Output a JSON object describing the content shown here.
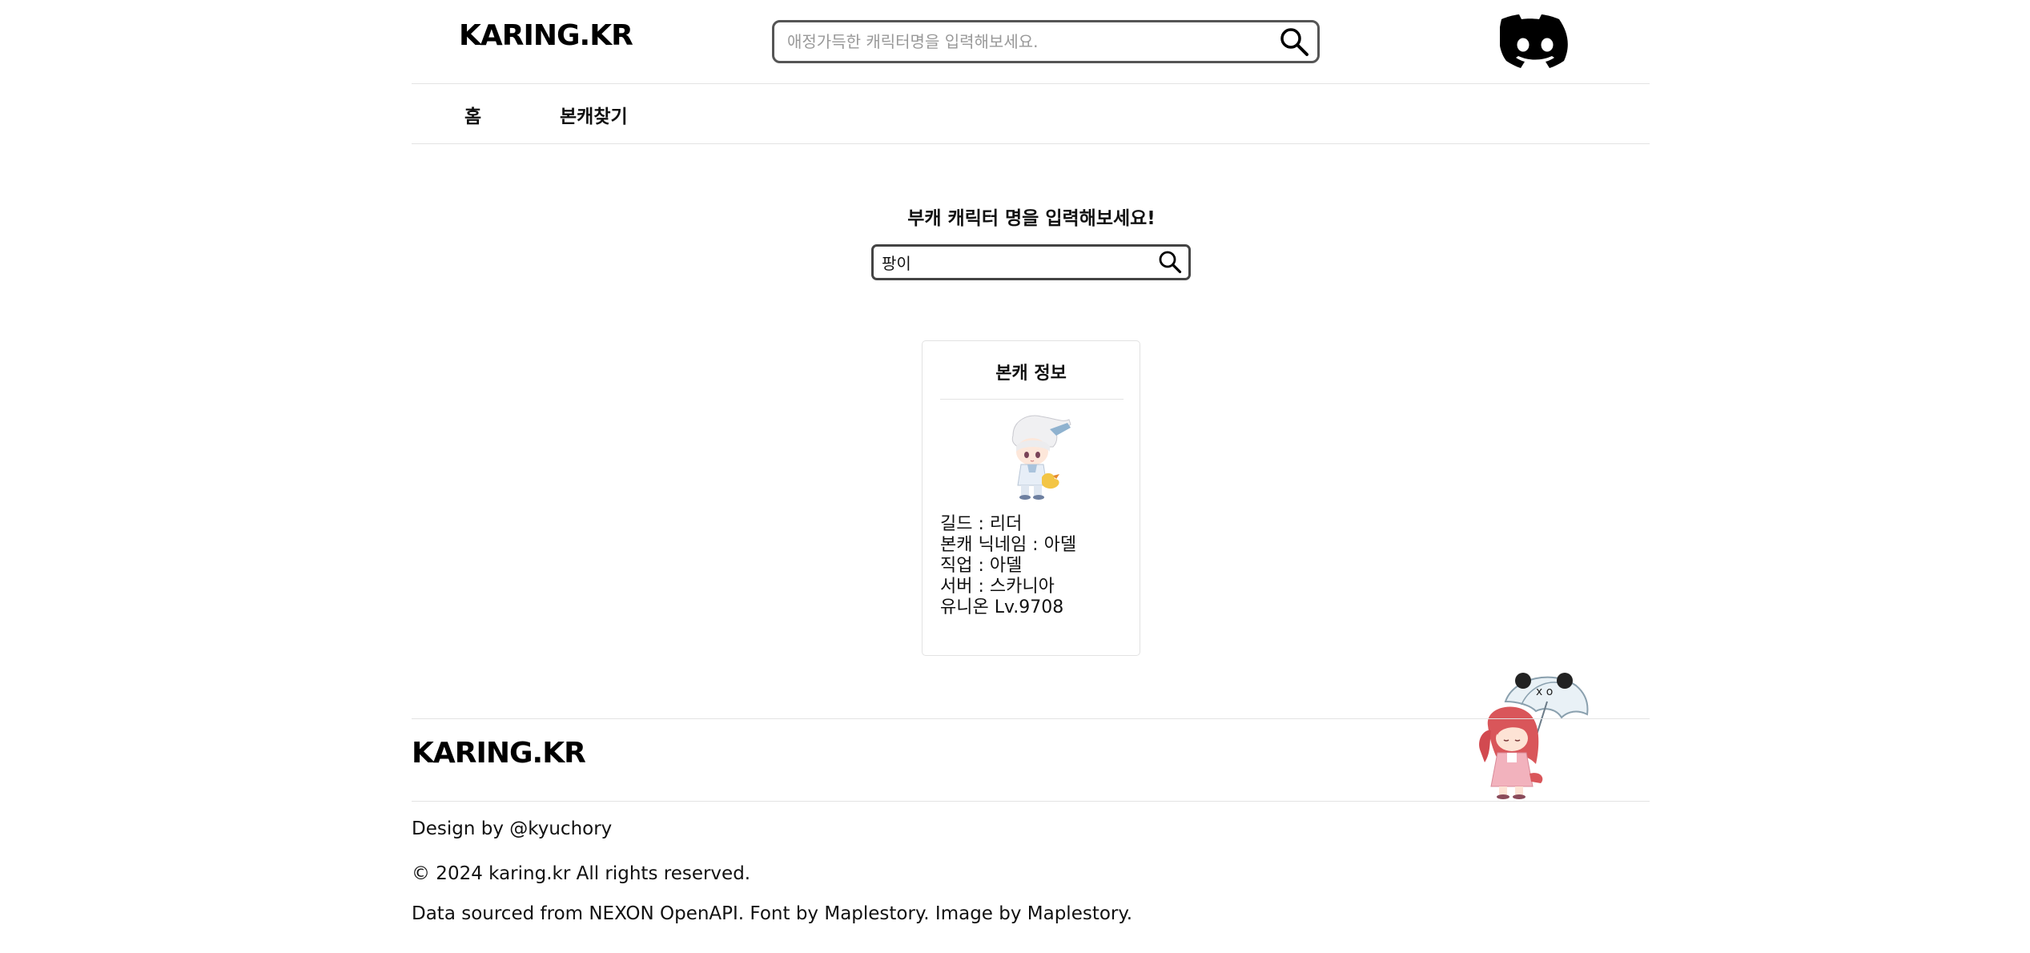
{
  "header": {
    "logo": "KARING.KR",
    "search_placeholder": "애정가득한 캐릭터명을 입력해보세요."
  },
  "nav": {
    "items": [
      {
        "label": "홈"
      },
      {
        "label": "본캐찾기"
      }
    ]
  },
  "main": {
    "prompt": "부캐 캐릭터 명을 입력해보세요!",
    "search_value": "팡이"
  },
  "card": {
    "title": "본캐 정보",
    "lines": [
      "길드 : 리더",
      "본캐 닉네임 : 아델",
      "직업 : 아델",
      "서버 : 스카니아",
      "유니온 Lv.9708"
    ]
  },
  "footer": {
    "logo": "KARING.KR",
    "design": "Design by @kyuchory",
    "copyright": "© 2024 karing.kr All rights reserved.",
    "sources": "Data sourced from NEXON OpenAPI. Font by Maplestory. Image by Maplestory."
  },
  "colors": {
    "border_dark": "#444444",
    "divider": "#e3e3e3",
    "text": "#111111"
  }
}
